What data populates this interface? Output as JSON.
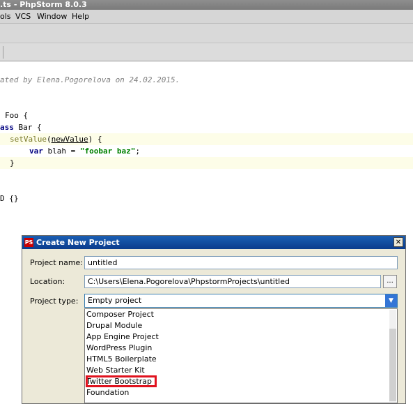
{
  "window": {
    "title": ".ts - PhpStorm 8.0.3"
  },
  "menu": [
    "ols",
    "VCS",
    "Window",
    "Help"
  ],
  "editor": {
    "comment": "ated by Elena.Pogorelova on 24.02.2015.",
    "line_foo": "Foo {",
    "line_bar_kw": "ass",
    "line_bar_rest": " Bar {",
    "line_method_fn": "setValue",
    "line_method_param": "newValue",
    "line_var_kw": "var",
    "line_var_name": " blah = ",
    "line_var_str": "\"foobar baz\"",
    "line_close": "}",
    "line_d": "D {}"
  },
  "dialog": {
    "title": "Create New Project",
    "close_label": "✕",
    "project_name_label": "Project name:",
    "project_name_value": "untitled",
    "location_label": "Location:",
    "location_value": "C:\\Users\\Elena.Pogorelova\\PhpstormProjects\\untitled",
    "browse_label": "...",
    "project_type_label": "Project type:",
    "project_type_value": "Empty project",
    "options": [
      "Composer Project",
      "Drupal Module",
      "App Engine Project",
      "WordPress Plugin",
      "HTML5 Boilerplate",
      "Web Starter Kit",
      "Twitter Bootstrap",
      "Foundation"
    ]
  },
  "colors": {
    "highlight": "#e0121e",
    "title_bar": "#0b3c8c"
  }
}
